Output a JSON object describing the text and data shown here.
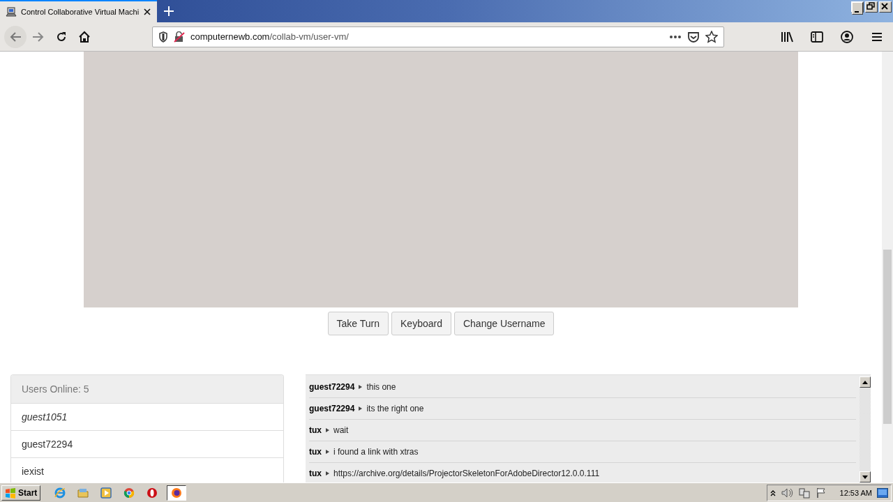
{
  "browser": {
    "tabs": [
      {
        "title": "Control Collaborative Virtual Machi",
        "selected": true
      }
    ],
    "address": {
      "host": "computernewb.com",
      "path": "/collab-vm/user-vm/"
    }
  },
  "vm": {
    "buttons": [
      "Take Turn",
      "Keyboard",
      "Change Username"
    ]
  },
  "users": {
    "header": "Users Online: 5",
    "items": [
      {
        "name": "guest1051",
        "current": true
      },
      {
        "name": "guest72294",
        "current": false
      },
      {
        "name": "iexist",
        "current": false
      }
    ]
  },
  "chat": {
    "messages": [
      {
        "user": "guest72294",
        "text": "this one"
      },
      {
        "user": "guest72294",
        "text": "its the right one"
      },
      {
        "user": "tux",
        "text": "wait"
      },
      {
        "user": "tux",
        "text": "i found a link with xtras"
      },
      {
        "user": "tux",
        "text": "https://archive.org/details/ProjectorSkeletonForAdobeDirector12.0.0.111"
      }
    ]
  },
  "taskbar": {
    "start": "Start",
    "apps": [
      {
        "kind": "ie",
        "active": false
      },
      {
        "kind": "folder",
        "active": false
      },
      {
        "kind": "media",
        "active": false
      },
      {
        "kind": "chrome",
        "active": false
      },
      {
        "kind": "opera",
        "active": false
      },
      {
        "kind": "firefox",
        "active": true
      }
    ],
    "clock": "12:53 AM"
  }
}
